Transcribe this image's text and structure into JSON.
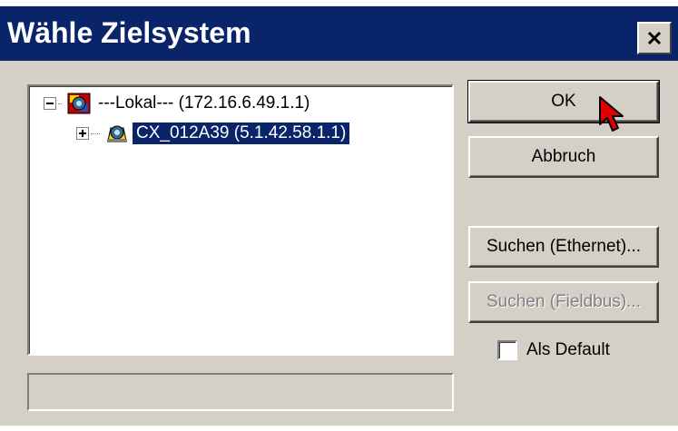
{
  "window": {
    "title": "Wähle Zielsystem",
    "close_icon": "close-icon"
  },
  "tree": {
    "nodes": [
      {
        "label": "---Lokal---    (172.16.6.49.1.1)",
        "expanded": true,
        "selected": false,
        "icon": "plc-system-icon"
      },
      {
        "label": "CX_012A39    (5.1.42.58.1.1)",
        "expanded": false,
        "selected": true,
        "icon": "plc-target-icon"
      }
    ]
  },
  "buttons": {
    "ok": "OK",
    "cancel": "Abbruch",
    "search_ethernet": "Suchen (Ethernet)...",
    "search_fieldbus": "Suchen (Fieldbus)..."
  },
  "default_checkbox": {
    "label": "Als Default",
    "checked": false
  },
  "status": {
    "text": ""
  },
  "colors": {
    "titlebar": "#0a246a",
    "dialog_bg": "#d4d0c8",
    "selection": "#0a246a"
  }
}
